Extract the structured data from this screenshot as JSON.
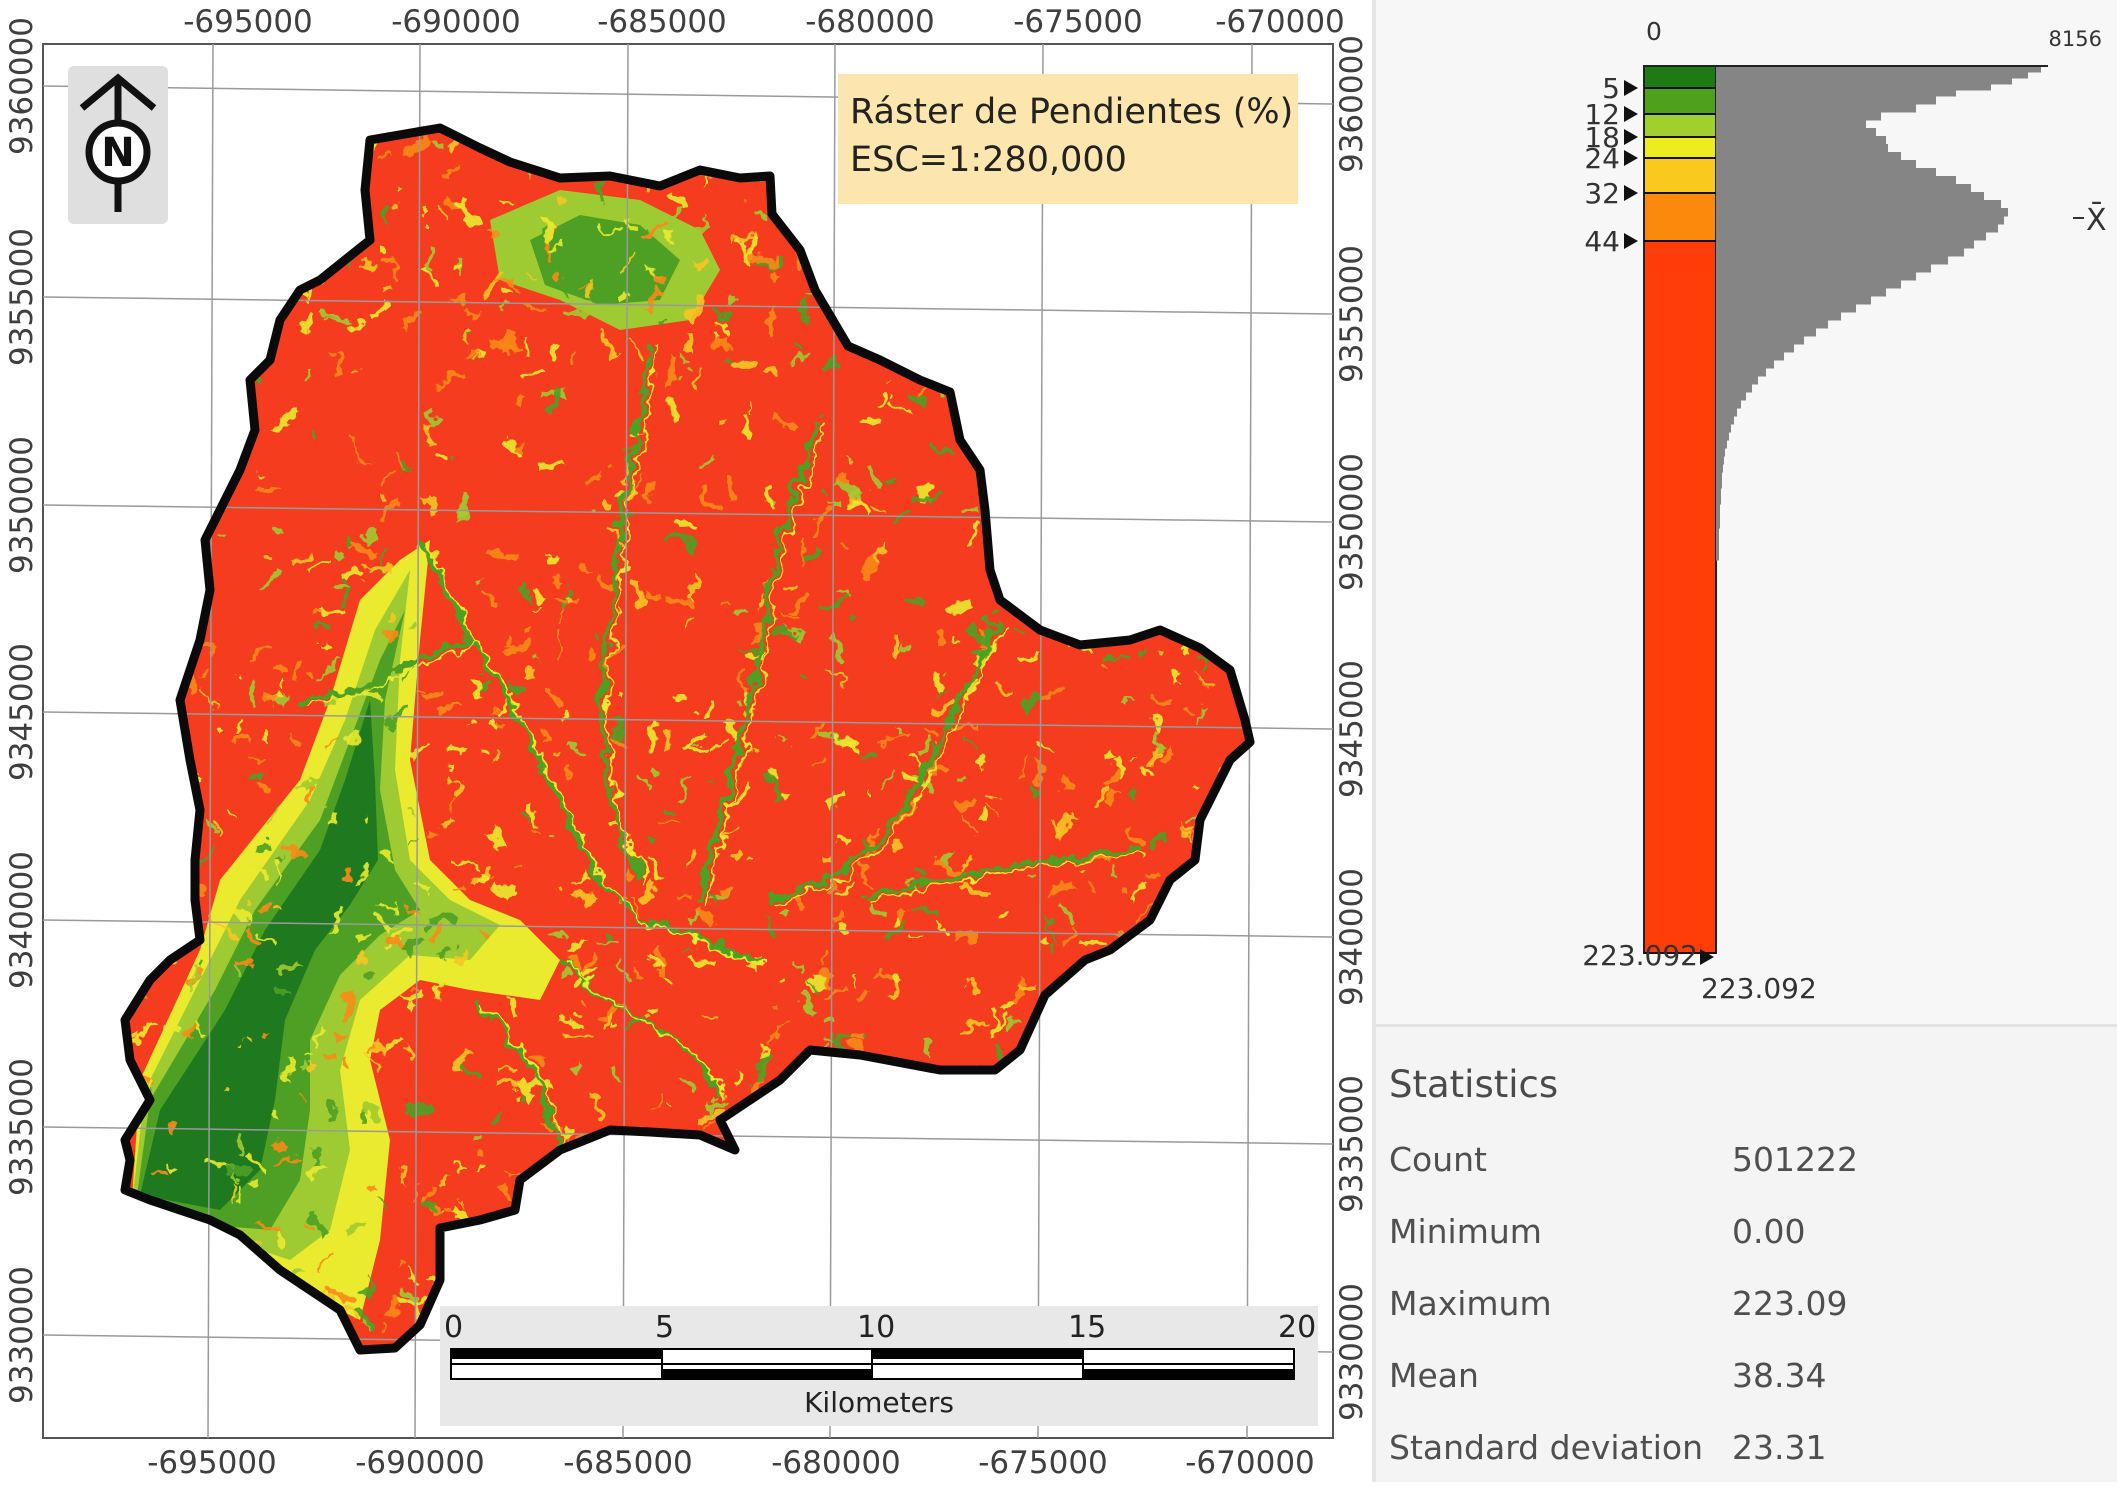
{
  "map": {
    "x_labels": [
      "-695000",
      "-690000",
      "-685000",
      "-680000",
      "-675000",
      "-670000"
    ],
    "y_labels": [
      "9360000",
      "9355000",
      "9350000",
      "9345000",
      "9340000",
      "9335000",
      "9330000"
    ],
    "legend": {
      "title": "Ráster de Pendientes (%)",
      "scale": "ESC=1:280,000"
    },
    "north_arrow": {
      "icon": "north-arrow-icon",
      "letter": "N"
    },
    "scalebar": {
      "ticks": [
        "0",
        "5",
        "10",
        "15",
        "20"
      ],
      "units": "Kilometers"
    },
    "colors": {
      "very_low": "#1f7a1f",
      "low": "#4ea024",
      "medium_low": "#9fcb32",
      "medium": "#eaea2e",
      "medium_high": "#f7c623",
      "high": "#fa8a1a",
      "very_high": "#f53c1e"
    }
  },
  "histogram": {
    "axis_min": "0",
    "axis_max": "8156",
    "breaks": [
      "5",
      "12",
      "18",
      "24",
      "32",
      "44"
    ],
    "bottom_break": "223.092",
    "bottom_value": "223.092",
    "mean_marker": "X̄",
    "classes": [
      {
        "color": "#1e7a12"
      },
      {
        "color": "#4fa11c"
      },
      {
        "color": "#a3cf2c"
      },
      {
        "color": "#eeeb1f"
      },
      {
        "color": "#f9c91e"
      },
      {
        "color": "#fb8a0c"
      },
      {
        "color": "#ff3d08"
      }
    ],
    "bar_color": "#858585"
  },
  "statistics": {
    "title": "Statistics",
    "rows": [
      {
        "label": "Count",
        "value": "501222"
      },
      {
        "label": "Minimum",
        "value": "0.00"
      },
      {
        "label": "Maximum",
        "value": "223.09"
      },
      {
        "label": "Mean",
        "value": "38.34"
      },
      {
        "label": "Standard deviation",
        "value": "23.31"
      }
    ]
  }
}
